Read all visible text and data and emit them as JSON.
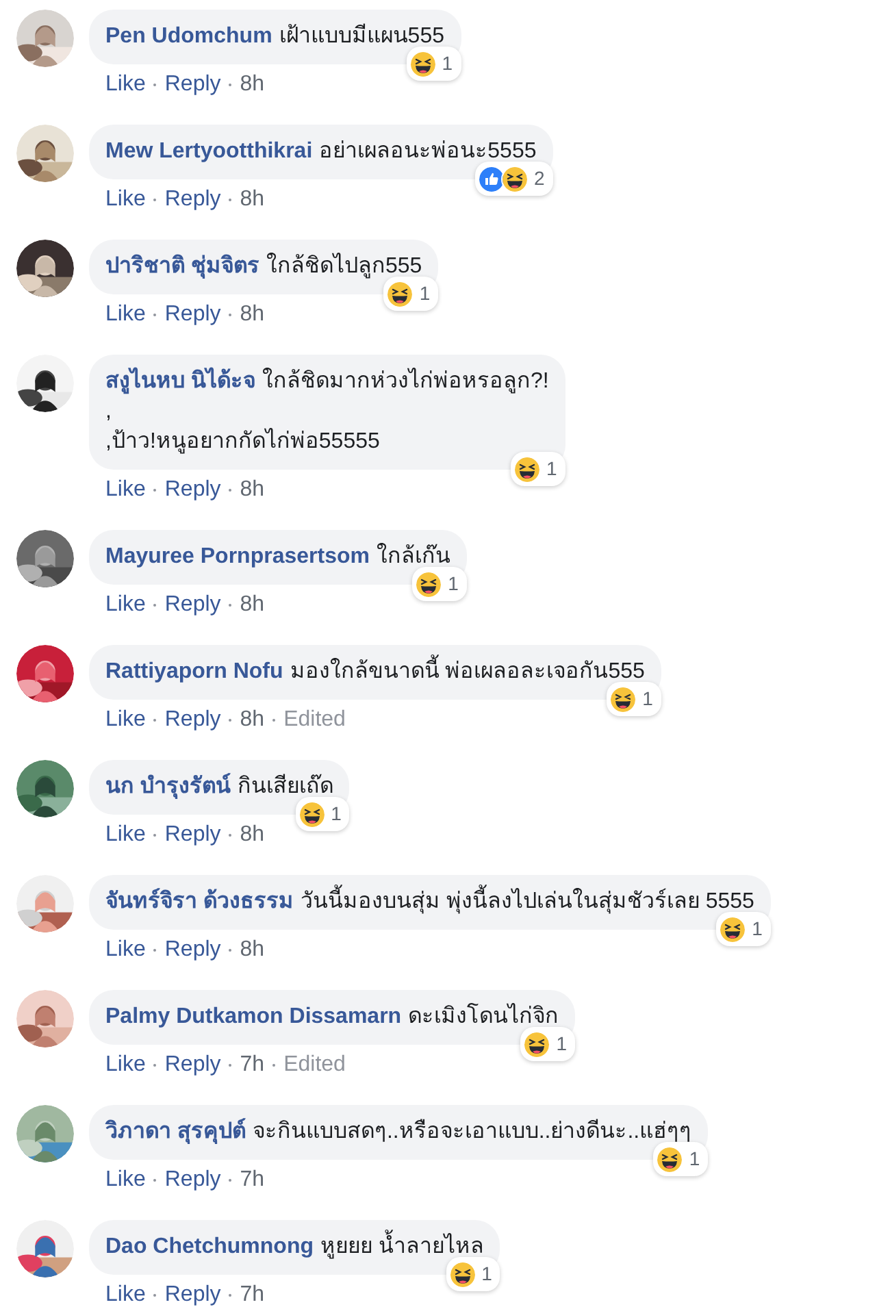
{
  "comments": [
    {
      "author": "Pen Udomchum",
      "lines": [
        "เฝ้าแบบมีแผน555"
      ],
      "reactions": [
        {
          "kind": "haha"
        }
      ],
      "reaction_count": "1",
      "actions": [
        "Like",
        "Reply"
      ],
      "time": "8h"
    },
    {
      "author": "Mew Lertyootthikrai",
      "lines": [
        "อย่าเผลอนะพ่อนะ5555"
      ],
      "reactions": [
        {
          "kind": "like"
        },
        {
          "kind": "haha"
        }
      ],
      "reaction_count": "2",
      "actions": [
        "Like",
        "Reply"
      ],
      "time": "8h"
    },
    {
      "author": "ปาริชาติ ชุ่มจิตร",
      "lines": [
        "ใกล้ชิดไปลูก555"
      ],
      "reactions": [
        {
          "kind": "haha"
        }
      ],
      "reaction_count": "1",
      "actions": [
        "Like",
        "Reply"
      ],
      "time": "8h"
    },
    {
      "author": "สงูไนหบ นิได้ะจ",
      "lines": [
        "ใกล้ชิดมากห่วงไก่พ่อหรอลูก?!",
        ",",
        ",ป้าว!หนูอยากกัดไก่พ่อ55555"
      ],
      "reactions": [
        {
          "kind": "haha"
        }
      ],
      "reaction_count": "1",
      "actions": [
        "Like",
        "Reply"
      ],
      "time": "8h"
    },
    {
      "author": "Mayuree Pornprasertsom",
      "lines": [
        "ใกล้เก๊น"
      ],
      "reactions": [
        {
          "kind": "haha"
        }
      ],
      "reaction_count": "1",
      "actions": [
        "Like",
        "Reply"
      ],
      "time": "8h"
    },
    {
      "author": "Rattiyaporn Nofu",
      "lines": [
        "มองใกล้ขนาดนี้ พ่อเผลอละเจอกัน555"
      ],
      "reactions": [
        {
          "kind": "haha"
        }
      ],
      "reaction_count": "1",
      "actions": [
        "Like",
        "Reply"
      ],
      "time": "8h",
      "edited": "Edited"
    },
    {
      "author": "นก บำรุงรัตน์",
      "lines": [
        "กินเสียเถ๊ด"
      ],
      "reactions": [
        {
          "kind": "haha"
        }
      ],
      "reaction_count": "1",
      "actions": [
        "Like",
        "Reply"
      ],
      "time": "8h"
    },
    {
      "author": "จันทร์จิรา ด้วงธรรม",
      "lines": [
        "วันนี้มองบนสุ่ม พุ่งนี้ลงไปเล่นในสุ่มชัวร์เลย 5555"
      ],
      "reactions": [
        {
          "kind": "haha"
        }
      ],
      "reaction_count": "1",
      "actions": [
        "Like",
        "Reply"
      ],
      "time": "8h"
    },
    {
      "author": "Palmy Dutkamon Dissamarn",
      "lines": [
        "ดะเมิงโดนไก่จิก"
      ],
      "reactions": [
        {
          "kind": "haha"
        }
      ],
      "reaction_count": "1",
      "actions": [
        "Like",
        "Reply"
      ],
      "time": "7h",
      "edited": "Edited"
    },
    {
      "author": "วิภาดา สุรคุปต์",
      "lines": [
        "จะกินแบบสดๆ..หรือจะเอาแบบ..ย่างดีนะ..แฮ่ๆๆ"
      ],
      "reactions": [
        {
          "kind": "haha"
        }
      ],
      "reaction_count": "1",
      "actions": [
        "Like",
        "Reply"
      ],
      "time": "7h"
    },
    {
      "author": "Dao Chetchumnong",
      "lines": [
        "หูยยย น้ำลายไหล"
      ],
      "reactions": [
        {
          "kind": "haha"
        }
      ],
      "reaction_count": "1",
      "actions": [
        "Like",
        "Reply"
      ],
      "time": "7h"
    }
  ]
}
